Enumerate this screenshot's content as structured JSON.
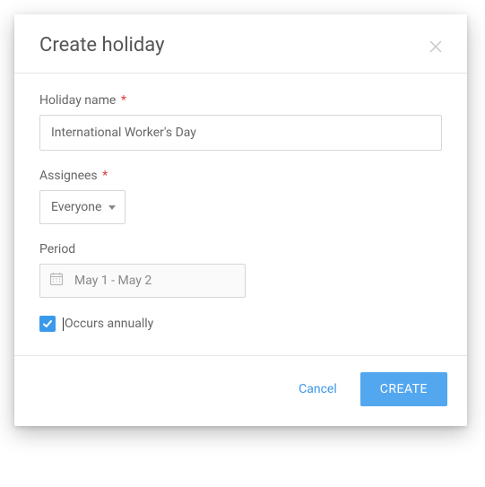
{
  "modal": {
    "title": "Create holiday"
  },
  "fields": {
    "holiday_name": {
      "label": "Holiday name",
      "required": "*",
      "value": "International Worker's Day"
    },
    "assignees": {
      "label": "Assignees",
      "required": "*",
      "selected": "Everyone"
    },
    "period": {
      "label": "Period",
      "value": "May 1 - May 2"
    },
    "annual": {
      "label": "Occurs annually",
      "checked": true
    }
  },
  "footer": {
    "cancel": "Cancel",
    "create": "CREATE"
  }
}
